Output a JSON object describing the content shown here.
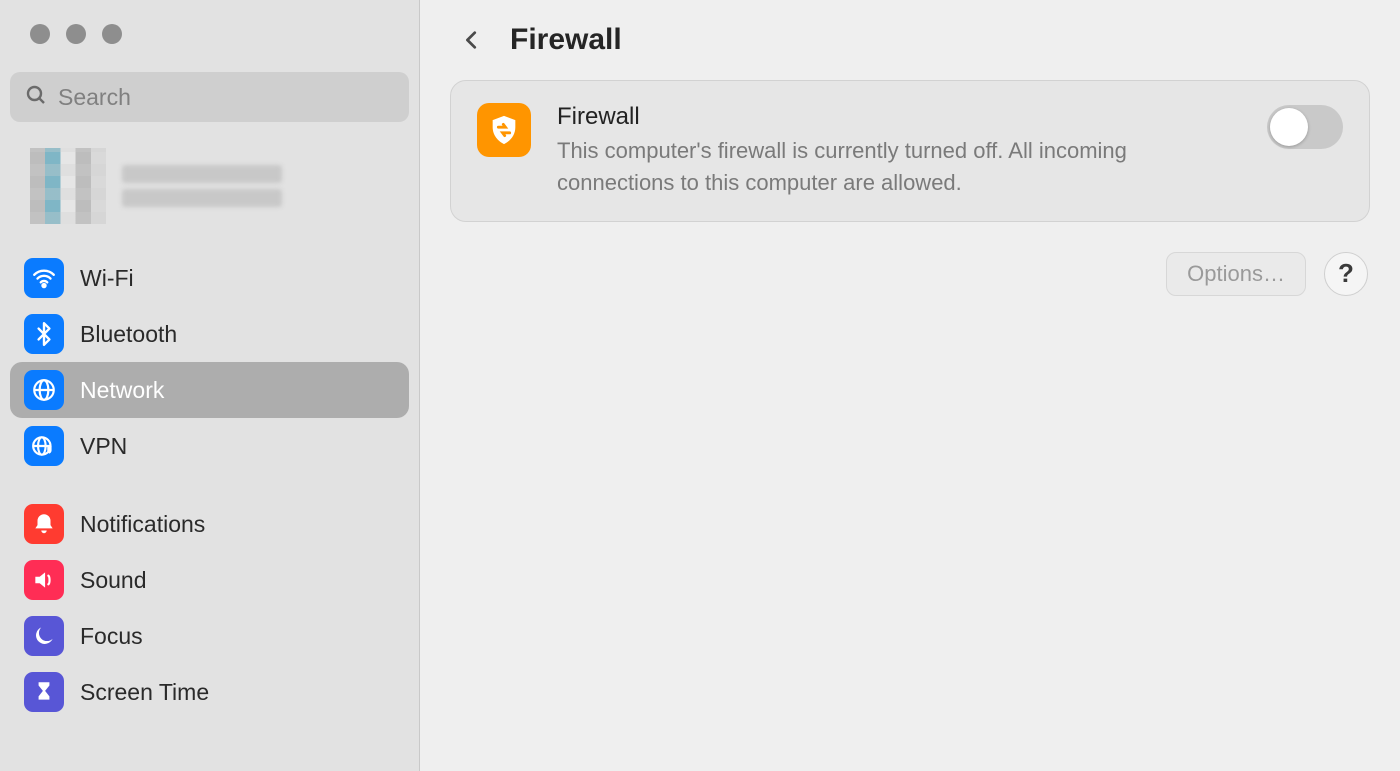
{
  "page": {
    "title": "Firewall"
  },
  "search": {
    "placeholder": "Search"
  },
  "sidebar": {
    "items": [
      {
        "id": "wifi",
        "label": "Wi-Fi",
        "icon": "wifi-icon",
        "color": "blue",
        "selected": false
      },
      {
        "id": "bluetooth",
        "label": "Bluetooth",
        "icon": "bluetooth-icon",
        "color": "blue",
        "selected": false
      },
      {
        "id": "network",
        "label": "Network",
        "icon": "globe-icon",
        "color": "blue",
        "selected": true
      },
      {
        "id": "vpn",
        "label": "VPN",
        "icon": "vpn-icon",
        "color": "blue",
        "selected": false
      },
      {
        "id": "notifications",
        "label": "Notifications",
        "icon": "bell-icon",
        "color": "red",
        "selected": false
      },
      {
        "id": "sound",
        "label": "Sound",
        "icon": "speaker-icon",
        "color": "pink",
        "selected": false
      },
      {
        "id": "focus",
        "label": "Focus",
        "icon": "moon-icon",
        "color": "indigo",
        "selected": false
      },
      {
        "id": "screentime",
        "label": "Screen Time",
        "icon": "hourglass-icon",
        "color": "indigo",
        "selected": false
      }
    ]
  },
  "firewall_card": {
    "title": "Firewall",
    "description": "This computer's firewall is currently turned off. All incoming connections to this computer are allowed.",
    "enabled": false
  },
  "actions": {
    "options_label": "Options…",
    "help_label": "?"
  },
  "colors": {
    "accent_blue": "#0a7bff",
    "accent_orange": "#ff9500",
    "accent_red": "#ff3b30",
    "accent_pink": "#ff2d55",
    "accent_indigo": "#5856d6"
  }
}
